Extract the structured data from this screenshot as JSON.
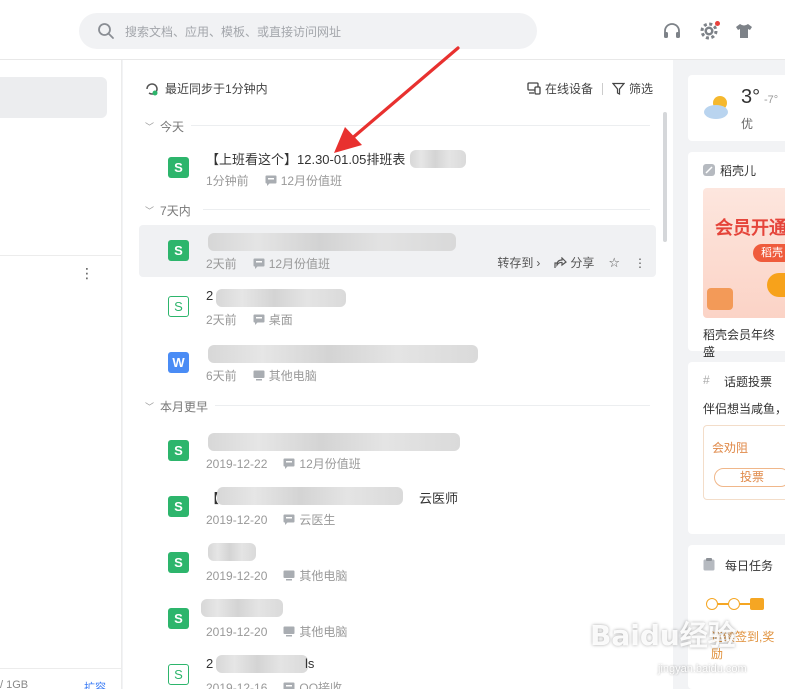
{
  "search": {
    "placeholder": "搜索文档、应用、模板、或直接访问网址"
  },
  "sidebar": {
    "storage": "/ 1GB",
    "expand": "扩容"
  },
  "list": {
    "sync_text": "最近同步于1分钟内",
    "online_devices": "在线设备",
    "filter": "筛选",
    "groups": {
      "today": "今天",
      "week": "7天内",
      "earlier": "本月更早"
    },
    "row_actions": {
      "move": "转存到",
      "share": "分享"
    },
    "files": [
      {
        "name": "【上班看这个】12.30-01.05排班表",
        "time": "1分钟前",
        "location": "12月份值班",
        "icon": "S"
      },
      {
        "name": "",
        "time": "2天前",
        "location": "12月份值班",
        "icon": "S"
      },
      {
        "name": "2",
        "time": "2天前",
        "location": "桌面",
        "icon": "S"
      },
      {
        "name": "",
        "time": "6天前",
        "location": "其他电脑",
        "icon": "W"
      },
      {
        "name": "",
        "time": "2019-12-22",
        "location": "12月份值班",
        "icon": "S"
      },
      {
        "name": "【",
        "name_tail": "云医师",
        "time": "2019-12-20",
        "location": "云医生",
        "icon": "S"
      },
      {
        "name": "",
        "time": "2019-12-20",
        "location": "其他电脑",
        "icon": "S"
      },
      {
        "name": "",
        "time": "2019-12-20",
        "location": "其他电脑",
        "icon": "S"
      },
      {
        "name": "2",
        "name_tail": "ls",
        "time": "2019-12-16",
        "location": "QQ接收",
        "icon": "S"
      }
    ]
  },
  "weather": {
    "temp": "3°",
    "low": "-7°",
    "air": "优"
  },
  "promo": {
    "title": "稻壳儿",
    "banner_text": "会员开通",
    "banner_pill": "稻壳",
    "caption": "稻壳会员年终盛"
  },
  "topic": {
    "title": "话题投票",
    "question": "伴侣想当咸鱼，",
    "option": "会劝阻",
    "vote": "投票"
  },
  "tasks": {
    "title": "每日任务",
    "reward": "连续签到,奖励"
  },
  "watermark": {
    "brand": "Baidu经验",
    "url": "jingyan.baidu.com"
  },
  "colors": {
    "sheet_green": "#2db56c",
    "writer_blue": "#4a8cf5",
    "arrow_red": "#e8312f",
    "accent_orange": "#f5a623"
  }
}
